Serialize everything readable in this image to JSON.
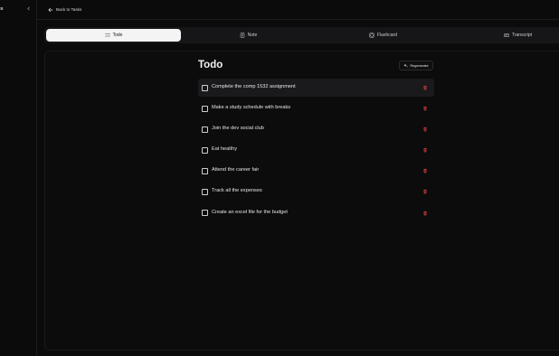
{
  "sidebar": {
    "label": "es"
  },
  "topbar": {
    "back_label": "Back to Tasks"
  },
  "tabs": [
    {
      "label": "Todo",
      "icon": "list-check-icon",
      "active": true
    },
    {
      "label": "Note",
      "icon": "note-icon",
      "active": false
    },
    {
      "label": "Flashcard",
      "icon": "flashcard-icon",
      "active": false
    },
    {
      "label": "Transcript",
      "icon": "transcript-icon",
      "active": false
    }
  ],
  "main": {
    "title": "Todo",
    "regenerate_label": "Regenerate",
    "todos": [
      {
        "text": "Complete the comp 1532 assignment",
        "checked": false
      },
      {
        "text": "Make a study schedule with breaks",
        "checked": false
      },
      {
        "text": "Join the dev social club",
        "checked": false
      },
      {
        "text": "Eat healthy",
        "checked": false
      },
      {
        "text": "Attend the career fair",
        "checked": false
      },
      {
        "text": "Track all the expenses",
        "checked": false
      },
      {
        "text": "Create an excel file for the budget",
        "checked": false
      }
    ]
  },
  "colors": {
    "background": "#0b0b0c",
    "active_tab": "#f4f4f5",
    "delete_icon": "#d13a3a"
  }
}
